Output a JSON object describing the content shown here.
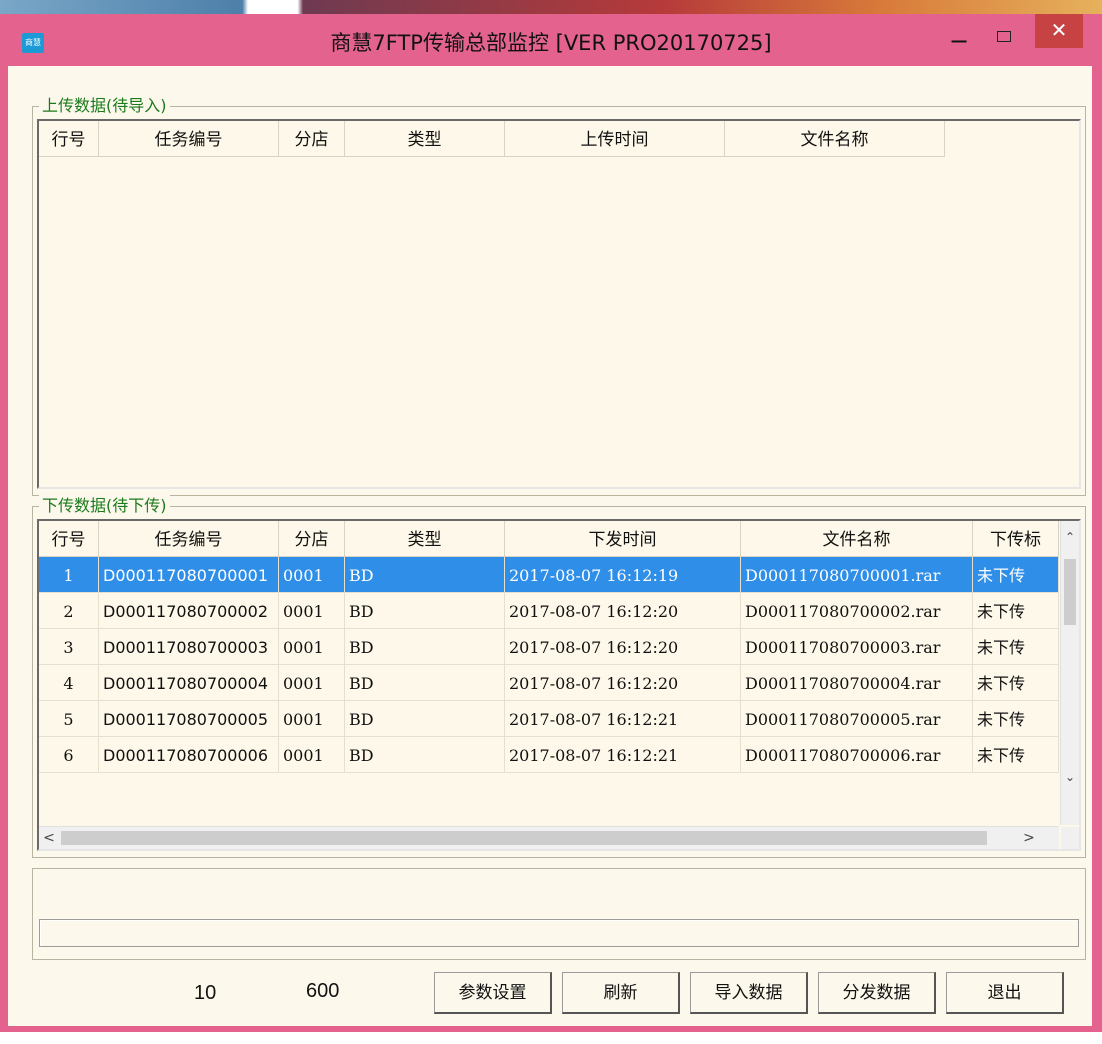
{
  "window": {
    "title": "商慧7FTP传输总部监控 [VER PRO20170725]",
    "icon_text": "商慧",
    "minimize_glyph": "−",
    "close_glyph": "✕"
  },
  "upload_group": {
    "label": "上传数据(待导入)",
    "columns": [
      "行号",
      "任务编号",
      "分店",
      "类型",
      "上传时间",
      "文件名称"
    ],
    "rows": []
  },
  "download_group": {
    "label": "下传数据(待下传)",
    "columns": [
      "行号",
      "任务编号",
      "分店",
      "类型",
      "下发时间",
      "文件名称",
      "下传标"
    ],
    "rows": [
      {
        "no": "1",
        "task": "D000117080700001",
        "store": "0001",
        "type": "BD",
        "time": "2017-08-07 16:12:19",
        "file": "D000117080700001.rar",
        "flag": "未下传"
      },
      {
        "no": "2",
        "task": "D000117080700002",
        "store": "0001",
        "type": "BD",
        "time": "2017-08-07 16:12:20",
        "file": "D000117080700002.rar",
        "flag": "未下传"
      },
      {
        "no": "3",
        "task": "D000117080700003",
        "store": "0001",
        "type": "BD",
        "time": "2017-08-07 16:12:20",
        "file": "D000117080700003.rar",
        "flag": "未下传"
      },
      {
        "no": "4",
        "task": "D000117080700004",
        "store": "0001",
        "type": "BD",
        "time": "2017-08-07 16:12:20",
        "file": "D000117080700004.rar",
        "flag": "未下传"
      },
      {
        "no": "5",
        "task": "D000117080700005",
        "store": "0001",
        "type": "BD",
        "time": "2017-08-07 16:12:21",
        "file": "D000117080700005.rar",
        "flag": "未下传"
      },
      {
        "no": "6",
        "task": "D000117080700006",
        "store": "0001",
        "type": "BD",
        "time": "2017-08-07 16:12:21",
        "file": "D000117080700006.rar",
        "flag": "未下传"
      }
    ],
    "selected_row": 0
  },
  "scroll": {
    "up": "⌃",
    "down": "⌄",
    "left": "<",
    "right": ">"
  },
  "footer": {
    "value1": "10",
    "value2": "600",
    "buttons": {
      "settings": "参数设置",
      "refresh": "刷新",
      "import": "导入数据",
      "distribute": "分发数据",
      "exit": "退出"
    }
  },
  "colors": {
    "frame": "#e3638e",
    "panel": "#fcf9ec",
    "selection": "#2f8ee8",
    "group_label": "#1c7a1c"
  }
}
